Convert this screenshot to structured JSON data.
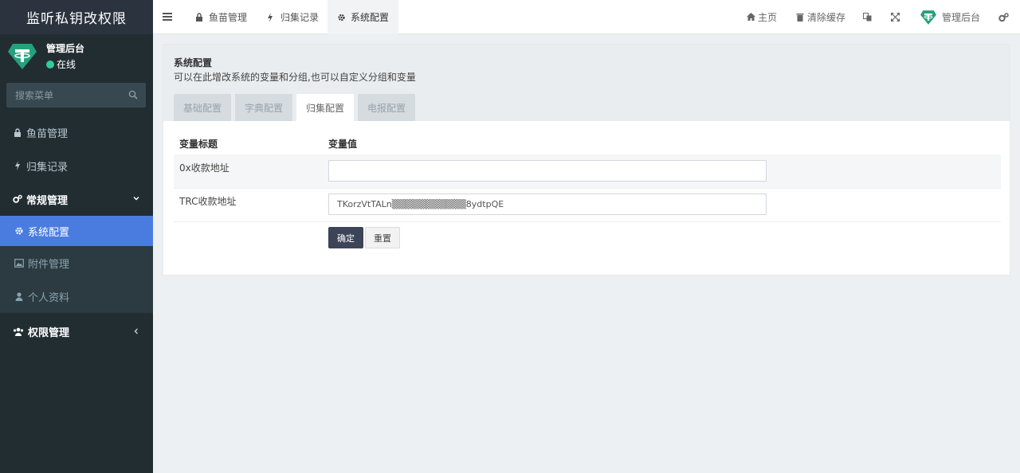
{
  "brand": {
    "title": "监听私钥改权限"
  },
  "user": {
    "name": "管理后台",
    "status": "在线",
    "status_color": "#33cc99"
  },
  "search": {
    "placeholder": "搜索菜单"
  },
  "sidebar": {
    "items": [
      {
        "label": "鱼苗管理",
        "icon": "lock-icon"
      },
      {
        "label": "归集记录",
        "icon": "bolt-icon"
      },
      {
        "label": "常规管理",
        "icon": "cogs-icon"
      },
      {
        "label": "系统配置",
        "icon": "gear-icon"
      },
      {
        "label": "附件管理",
        "icon": "image-icon"
      },
      {
        "label": "个人资料",
        "icon": "user-icon"
      },
      {
        "label": "权限管理",
        "icon": "group-icon"
      }
    ],
    "active_color": "#4a7cdf"
  },
  "header": {
    "tabs": [
      {
        "label": "鱼苗管理",
        "icon": "lock-icon"
      },
      {
        "label": "归集记录",
        "icon": "bolt-icon"
      },
      {
        "label": "系统配置",
        "icon": "gear-icon"
      }
    ],
    "right": {
      "home": "主页",
      "clear_cache": "清除缓存",
      "admin": "管理后台"
    }
  },
  "panel": {
    "title": "系统配置",
    "description": "可以在此增改系统的变量和分组,也可以自定义分组和变量",
    "tabs": [
      "基础配置",
      "字典配置",
      "归集配置",
      "电报配置"
    ],
    "active_tab": "归集配置"
  },
  "table": {
    "headers": {
      "title": "变量标题",
      "value": "变量值"
    },
    "rows": [
      {
        "label": "0x收款地址",
        "value": ""
      },
      {
        "label": "TRC收款地址",
        "value": "TKorzVtTALn▒▒▒▒▒▒▒▒▒▒▒8ydtpQE"
      }
    ]
  },
  "buttons": {
    "confirm": "确定",
    "reset": "重置"
  }
}
